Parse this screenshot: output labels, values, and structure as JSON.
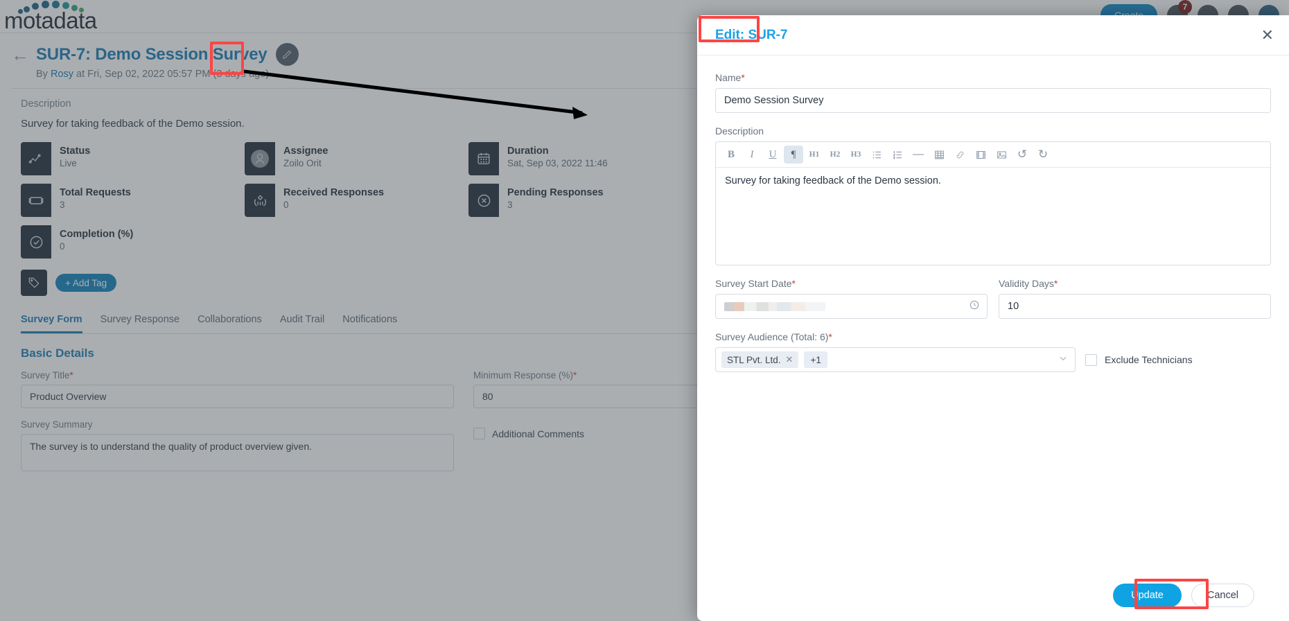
{
  "app": {
    "brand": "motadata",
    "topbar": {
      "create_label": "Create",
      "notification_count": "7"
    }
  },
  "page": {
    "back_icon": "arrow-left-icon",
    "title": "SUR-7: Demo Session Survey",
    "edit_icon": "pencil-icon",
    "byline_prefix": "By",
    "byline_author": "Rosy",
    "byline_rest": "at Fri, Sep 02, 2022 05:57 PM (3 days ago)",
    "description_label": "Description",
    "description_text": "Survey for taking feedback of the Demo session."
  },
  "cards": [
    {
      "icon": "trend-line-icon",
      "label": "Status",
      "value": "Live"
    },
    {
      "icon": "user-avatar-icon",
      "label": "Assignee",
      "value": "Zoilo Orit"
    },
    {
      "icon": "calendar-icon",
      "label": "Duration",
      "value": "Sat, Sep 03, 2022 11:46 "
    },
    {
      "icon": "ticket-icon",
      "label": "Total Requests",
      "value": "3"
    },
    {
      "icon": "hands-diamond-icon",
      "label": "Received Responses",
      "value": "0"
    },
    {
      "icon": "circle-x-icon",
      "label": "Pending Responses",
      "value": "3"
    },
    {
      "icon": "check-circle-icon",
      "label": "Completion (%)",
      "value": "0"
    }
  ],
  "tag_section": {
    "icon": "tag-icon",
    "add_tag_label": "+ Add Tag"
  },
  "tabs": [
    {
      "label": "Survey Form",
      "active": true
    },
    {
      "label": "Survey Response",
      "active": false
    },
    {
      "label": "Collaborations",
      "active": false
    },
    {
      "label": "Audit Trail",
      "active": false
    },
    {
      "label": "Notifications",
      "active": false
    }
  ],
  "basic_details": {
    "section_title": "Basic Details",
    "survey_title_label": "Survey Title",
    "survey_title_value": "Product Overview",
    "minimum_response_label": "Minimum Response (%)",
    "minimum_response_value": "80",
    "survey_summary_label": "Survey Summary",
    "survey_summary_value": "The survey is to understand the quality of product overview given.",
    "additional_comments_label": "Additional Comments"
  },
  "modal": {
    "title": "Edit: SUR-7",
    "close_icon": "close-icon",
    "name_label": "Name",
    "name_value": "Demo Session Survey",
    "description_label": "Description",
    "description_value": "Survey for taking feedback of the Demo session.",
    "toolbar": [
      {
        "name": "bold",
        "glyph": "B",
        "kind": "b",
        "active": false
      },
      {
        "name": "italic",
        "glyph": "I",
        "kind": "i",
        "active": false
      },
      {
        "name": "underline",
        "glyph": "U",
        "kind": "u",
        "active": false
      },
      {
        "name": "paragraph",
        "glyph": "¶",
        "kind": "p",
        "active": true
      },
      {
        "name": "heading-1",
        "glyph": "H1",
        "kind": "h",
        "active": false
      },
      {
        "name": "heading-2",
        "glyph": "H2",
        "kind": "h",
        "active": false
      },
      {
        "name": "heading-3",
        "glyph": "H3",
        "kind": "h",
        "active": false
      },
      {
        "name": "bullet-list",
        "glyph": "☰",
        "kind": "ul",
        "active": false
      },
      {
        "name": "numbered-list",
        "glyph": "☰",
        "kind": "ol",
        "active": false
      },
      {
        "name": "horizontal-rule",
        "glyph": "—",
        "kind": "hr",
        "active": false
      },
      {
        "name": "table",
        "glyph": "▦",
        "kind": "tbl",
        "active": false
      },
      {
        "name": "link",
        "glyph": "🔗",
        "kind": "lnk",
        "active": false
      },
      {
        "name": "video",
        "glyph": "▤",
        "kind": "vid",
        "active": false
      },
      {
        "name": "image",
        "glyph": "▣",
        "kind": "img",
        "active": false
      },
      {
        "name": "undo",
        "glyph": "↺",
        "kind": "un",
        "active": false
      },
      {
        "name": "redo",
        "glyph": "↻",
        "kind": "re",
        "active": false
      }
    ],
    "survey_start_date_label": "Survey Start Date",
    "survey_start_date_value": "",
    "clock_icon": "clock-icon",
    "validity_days_label": "Validity Days",
    "validity_days_value": "10",
    "survey_audience_label": "Survey Audience (Total: 6)",
    "audience_chips": [
      {
        "label": "STL Pvt. Ltd.",
        "removable": true
      },
      {
        "label": "+1",
        "removable": false
      }
    ],
    "exclude_technicians_label": "Exclude Technicians",
    "update_label": "Update",
    "cancel_label": "Cancel"
  },
  "colors": {
    "accent_blue": "#1578b3",
    "modal_title_blue": "#1ca1e6",
    "primary_button": "#0fa3e3",
    "annotation_red": "#fd4545",
    "card_icon_dark": "#1f2a37"
  }
}
